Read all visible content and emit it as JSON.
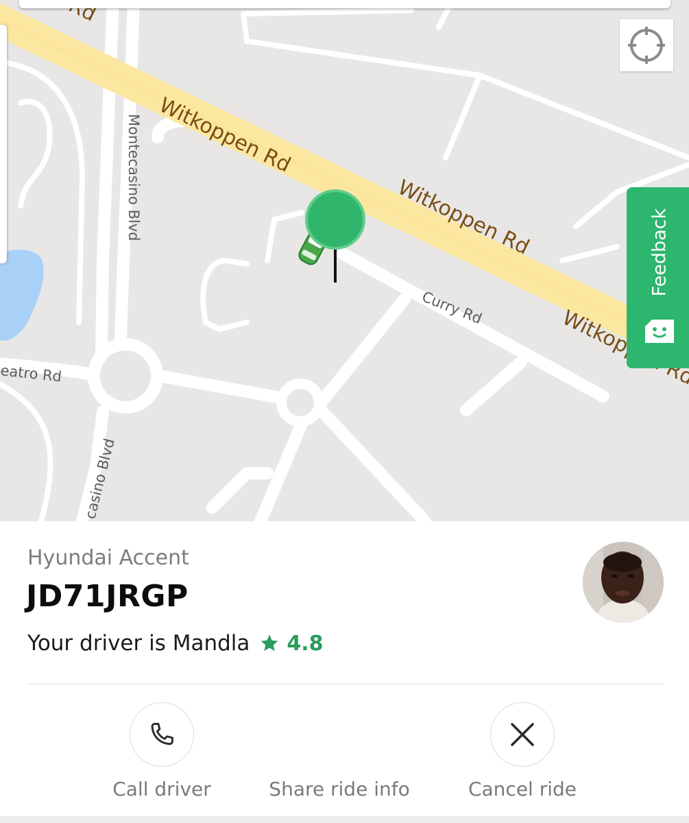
{
  "map": {
    "roads": {
      "witkoppen_1": "Witkoppen Rd",
      "witkoppen_2": "Witkoppen Rd",
      "witkoppen_3": "Witkoppen Rd",
      "witkoppen_top": "Rd",
      "montecasino_upper": "Montecasino Blvd",
      "montecasino_lower": "casino Blvd",
      "curry": "Curry Rd",
      "teatro": "eatro Rd"
    },
    "feedback_label": "Feedback",
    "accent_color": "#2db66d",
    "icons": {
      "locate": "crosshair-icon",
      "feedback": "smiley-icon",
      "pin": "pickup-pin-icon",
      "car": "car-icon"
    }
  },
  "ride": {
    "car_model": "Hyundai Accent",
    "plate": "JD71JRGP",
    "driver_prefix": "Your driver is Mandla",
    "rating": "4.8",
    "rating_color": "#2a9d5c"
  },
  "actions": {
    "call_label": "Call driver",
    "share_label": "Share ride info",
    "cancel_label": "Cancel ride"
  }
}
